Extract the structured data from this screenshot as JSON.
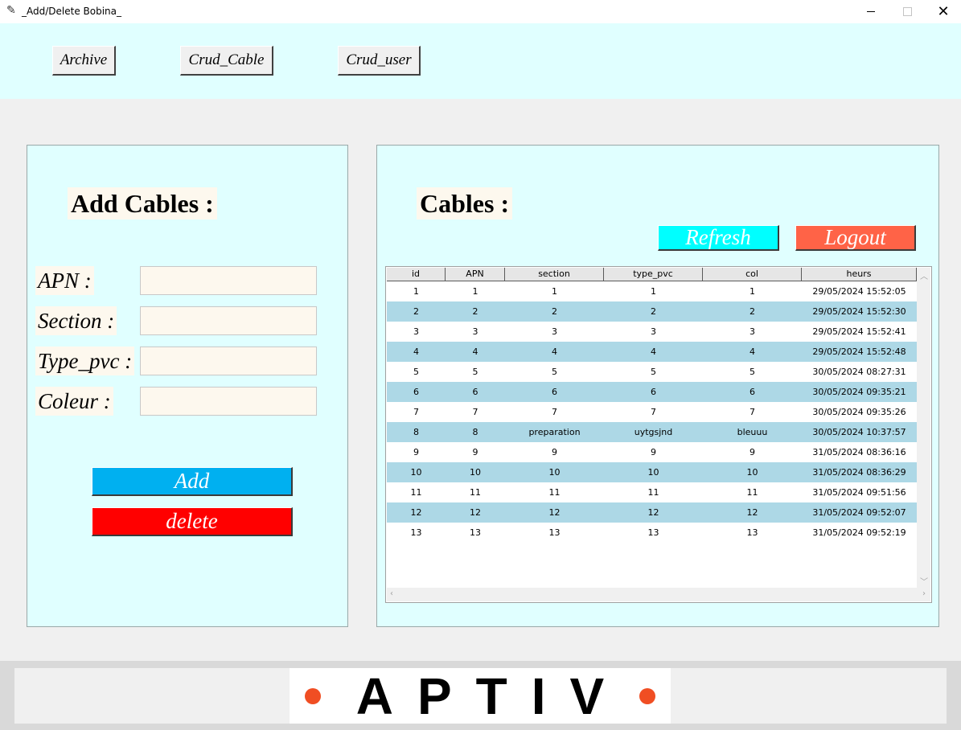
{
  "window": {
    "title": "_Add/Delete Bobina_",
    "icon": "feather-icon"
  },
  "nav": {
    "archive": "Archive",
    "crud_cable": "Crud_Cable",
    "crud_user": "Crud_user"
  },
  "form": {
    "heading": "Add Cables :",
    "apn_label": "APN :",
    "section_label": "Section :",
    "type_pvc_label": "Type_pvc :",
    "coleur_label": "Coleur :",
    "apn_value": "",
    "section_value": "",
    "type_pvc_value": "",
    "coleur_value": "",
    "add_label": "Add",
    "delete_label": "delete"
  },
  "cables": {
    "heading": "Cables :",
    "refresh_label": "Refresh",
    "logout_label": "Logout",
    "columns": [
      "id",
      "APN",
      "section",
      "type_pvc",
      "col",
      "heurs"
    ],
    "rows": [
      [
        "1",
        "1",
        "1",
        "1",
        "1",
        "29/05/2024 15:52:05"
      ],
      [
        "2",
        "2",
        "2",
        "2",
        "2",
        "29/05/2024 15:52:30"
      ],
      [
        "3",
        "3",
        "3",
        "3",
        "3",
        "29/05/2024 15:52:41"
      ],
      [
        "4",
        "4",
        "4",
        "4",
        "4",
        "29/05/2024 15:52:48"
      ],
      [
        "5",
        "5",
        "5",
        "5",
        "5",
        "30/05/2024 08:27:31"
      ],
      [
        "6",
        "6",
        "6",
        "6",
        "6",
        "30/05/2024 09:35:21"
      ],
      [
        "7",
        "7",
        "7",
        "7",
        "7",
        "30/05/2024 09:35:26"
      ],
      [
        "8",
        "8",
        "preparation",
        "uytgsjnd",
        "bleuuu",
        "30/05/2024 10:37:57"
      ],
      [
        "9",
        "9",
        "9",
        "9",
        "9",
        "31/05/2024 08:36:16"
      ],
      [
        "10",
        "10",
        "10",
        "10",
        "10",
        "31/05/2024 08:36:29"
      ],
      [
        "11",
        "11",
        "11",
        "11",
        "11",
        "31/05/2024 09:51:56"
      ],
      [
        "12",
        "12",
        "12",
        "12",
        "12",
        "31/05/2024 09:52:07"
      ],
      [
        "13",
        "13",
        "13",
        "13",
        "13",
        "31/05/2024 09:52:19"
      ]
    ]
  },
  "footer": {
    "logo_text": "APTIV"
  },
  "colors": {
    "add": "#00b0f0",
    "delete": "#ff0000",
    "refresh": "#00ffff",
    "logout": "#ff6347",
    "row_alt": "#add8e6",
    "panel": "#e0ffff",
    "logo_dot": "#f04e23"
  }
}
